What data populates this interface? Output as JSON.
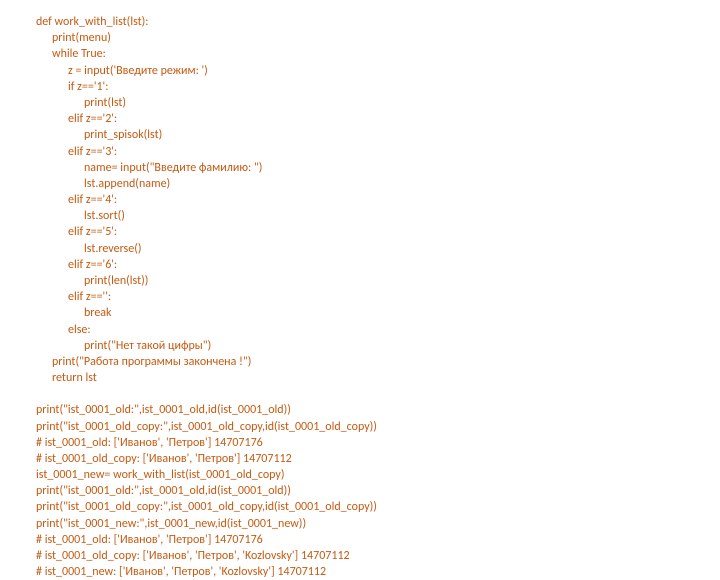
{
  "lines": [
    {
      "indent": 0,
      "text": "def work_with_list(lst):"
    },
    {
      "indent": 1,
      "text": "print(menu)"
    },
    {
      "indent": 1,
      "text": "while True:"
    },
    {
      "indent": 2,
      "text": "z = input('Введите режим: ')"
    },
    {
      "indent": 2,
      "text": "if z=='1':"
    },
    {
      "indent": 3,
      "text": "print(lst)"
    },
    {
      "indent": 2,
      "text": "elif z=='2':"
    },
    {
      "indent": 3,
      "text": "print_spisok(lst)"
    },
    {
      "indent": 2,
      "text": "elif z=='3':"
    },
    {
      "indent": 3,
      "text": "name= input(\"Введите фамилию: \")"
    },
    {
      "indent": 3,
      "text": "lst.append(name)"
    },
    {
      "indent": 2,
      "text": "elif z=='4':"
    },
    {
      "indent": 3,
      "text": "lst.sort()"
    },
    {
      "indent": 2,
      "text": "elif z=='5':"
    },
    {
      "indent": 3,
      "text": "lst.reverse()"
    },
    {
      "indent": 2,
      "text": "elif z=='6':"
    },
    {
      "indent": 3,
      "text": "print(len(lst))"
    },
    {
      "indent": 2,
      "text": "elif z=='':"
    },
    {
      "indent": 3,
      "text": "break"
    },
    {
      "indent": 2,
      "text": "else:"
    },
    {
      "indent": 3,
      "text": "print(\"Нет такой цифры\")"
    },
    {
      "indent": 1,
      "text": "print(\"Работа программы закончена !\")"
    },
    {
      "indent": 1,
      "text": "return lst"
    },
    {
      "indent": 0,
      "text": "",
      "gap": true
    },
    {
      "indent": 0,
      "text": "print(\"ist_0001_old:\",ist_0001_old,id(ist_0001_old))"
    },
    {
      "indent": 0,
      "text": "print(\"ist_0001_old_copy:\",ist_0001_old_copy,id(ist_0001_old_copy))"
    },
    {
      "indent": 0,
      "text": "# ist_0001_old: ['Иванов', 'Петров'] 14707176"
    },
    {
      "indent": 0,
      "text": "# ist_0001_old_copy: ['Иванов', 'Петров'] 14707112"
    },
    {
      "indent": 0,
      "text": "ist_0001_new= work_with_list(ist_0001_old_copy)"
    },
    {
      "indent": 0,
      "text": "print(\"ist_0001_old:\",ist_0001_old,id(ist_0001_old))"
    },
    {
      "indent": 0,
      "text": "print(\"ist_0001_old_copy:\",ist_0001_old_copy,id(ist_0001_old_copy))"
    },
    {
      "indent": 0,
      "text": "print(\"ist_0001_new:\",ist_0001_new,id(ist_0001_new))"
    },
    {
      "indent": 0,
      "text": "# ist_0001_old: ['Иванов', 'Петров'] 14707176"
    },
    {
      "indent": 0,
      "text": "# ist_0001_old_copy: ['Иванов', 'Петров', 'Kozlovsky'] 14707112"
    },
    {
      "indent": 0,
      "text": "# ist_0001_new: ['Иванов', 'Петров', 'Kozlovsky'] 14707112"
    }
  ]
}
